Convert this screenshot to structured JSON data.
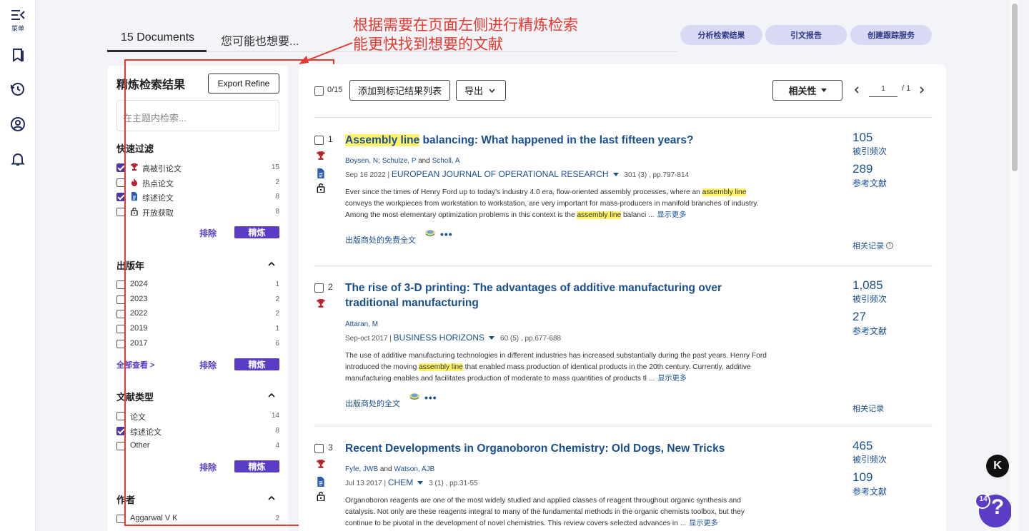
{
  "rail": {
    "menu_label": "菜单"
  },
  "tabs": {
    "documents": "15 Documents",
    "might_like": "您可能也想要..."
  },
  "header_buttons": {
    "analyze": "分析检索结果",
    "citation_report": "引文报告",
    "create_alert": "创建跟踪服务"
  },
  "annotation": {
    "line1": "根据需要在页面左侧进行精炼检索",
    "line2": "能更快找到想要的文献"
  },
  "refine": {
    "title": "精炼检索结果",
    "export_label": "Export Refine",
    "search_placeholder": "在主题内检索...",
    "exclude_label": "排除",
    "refine_label": "精炼",
    "view_all": "全部查看 >",
    "quick_filter": {
      "title": "快速过滤",
      "items": [
        {
          "label": "高被引论文",
          "count": "15",
          "checked": true,
          "icon": "trophy-icon"
        },
        {
          "label": "热点论文",
          "count": "2",
          "checked": false,
          "icon": "flame-icon"
        },
        {
          "label": "综述论文",
          "count": "8",
          "checked": true,
          "icon": "document-icon"
        },
        {
          "label": "开放获取",
          "count": "8",
          "checked": false,
          "icon": "lock-icon"
        }
      ]
    },
    "pub_year": {
      "title": "出版年",
      "items": [
        {
          "label": "2024",
          "count": "1"
        },
        {
          "label": "2023",
          "count": "2"
        },
        {
          "label": "2022",
          "count": "2"
        },
        {
          "label": "2019",
          "count": "1"
        },
        {
          "label": "2017",
          "count": "6"
        }
      ]
    },
    "doc_type": {
      "title": "文献类型",
      "items": [
        {
          "label": "论文",
          "count": "14",
          "checked": false
        },
        {
          "label": "综述论文",
          "count": "8",
          "checked": true
        },
        {
          "label": "Other",
          "count": "4",
          "checked": false
        }
      ]
    },
    "authors": {
      "title": "作者",
      "items": [
        {
          "label": "Aggarwal V K",
          "count": "2"
        }
      ]
    }
  },
  "toolbar": {
    "selected_count": "0/15",
    "add_to_marked": "添加到标记结果列表",
    "export": "导出",
    "sort": "相关性",
    "page_current": "1",
    "page_total": "/ 1"
  },
  "labels": {
    "times_cited": "被引频次",
    "references": "参考文献",
    "related_records": "相关记录",
    "show_more": "显示更多"
  },
  "records": [
    {
      "num": "1",
      "title_highlight": "Assembly line",
      "title_rest": " balancing: What happened in the last fifteen years?",
      "authors": [
        {
          "name": "Boysen, N"
        },
        {
          "sep": "; "
        },
        {
          "name": "Schulze, P"
        },
        {
          "sep": " and "
        },
        {
          "name": "Scholl, A"
        }
      ],
      "date": "Sep 16 2022 |",
      "journal": "EUROPEAN JOURNAL OF OPERATIONAL RESEARCH",
      "vol": "301 (3) , pp.797-814",
      "abstract_parts": [
        {
          "t": "Ever since the times of Henry Ford up to today's industry 4.0 era, flow-oriented assembly processes, where an "
        },
        {
          "h": "assembly line"
        },
        {
          "t": " conveys the workpieces from workstation to workstation, are very important for mass-producers in manifold branches of industry. Among the most elementary optimization problems in this context is the "
        },
        {
          "h": "assembly line"
        },
        {
          "t": " balanci ..."
        }
      ],
      "fulltext": "出版商处的免费全文",
      "times_cited": "105",
      "references": "289"
    },
    {
      "num": "2",
      "title_highlight": "",
      "title_rest": "The rise of 3-D printing: The advantages of additive manufacturing over traditional manufacturing",
      "authors": [
        {
          "name": "Attaran, M"
        }
      ],
      "date": "Sep-oct 2017 |",
      "journal": "BUSINESS HORIZONS",
      "vol": "60 (5) , pp.677-688",
      "abstract_parts": [
        {
          "t": "The use of additive manufacturing technologies in different industries has increased substantially during the past years. Henry Ford introduced the moving "
        },
        {
          "h": "assembly line"
        },
        {
          "t": " that enabled mass production of identical products in the 20th century. Currently, additive manufacturing enables and facilitates production of moderate to mass quantities of products tl ..."
        }
      ],
      "fulltext": "出版商处的全文",
      "times_cited": "1,085",
      "references": "27"
    },
    {
      "num": "3",
      "title_highlight": "",
      "title_rest": "Recent Developments in Organoboron Chemistry: Old Dogs, New Tricks",
      "authors": [
        {
          "name": "Fyfe, JWB"
        },
        {
          "sep": " and "
        },
        {
          "name": "Watson, AJB"
        }
      ],
      "date": "Jul 13 2017 |",
      "journal": "CHEM",
      "vol": "3 (1) , pp.31-55",
      "abstract_parts": [
        {
          "t": "Organoboron reagents are one of the most widely studied and applied classes of reagent throughout organic synthesis and catalysis. Not only are these reagents integral to many of the fundamental methods in the organic chemists toolbox, but they continue to be pivotal in the development of novel chemistries. This review covers selected advances in ..."
        }
      ],
      "fulltext": "",
      "times_cited": "465",
      "references": "109"
    }
  ],
  "badges": {
    "k_label": "K",
    "help_count": "14",
    "help_symbol": "?"
  },
  "colors": {
    "accent": "#5b3cc4",
    "link": "#1a4f8f",
    "annotation": "#e8382f",
    "highlight": "#fff36b"
  }
}
